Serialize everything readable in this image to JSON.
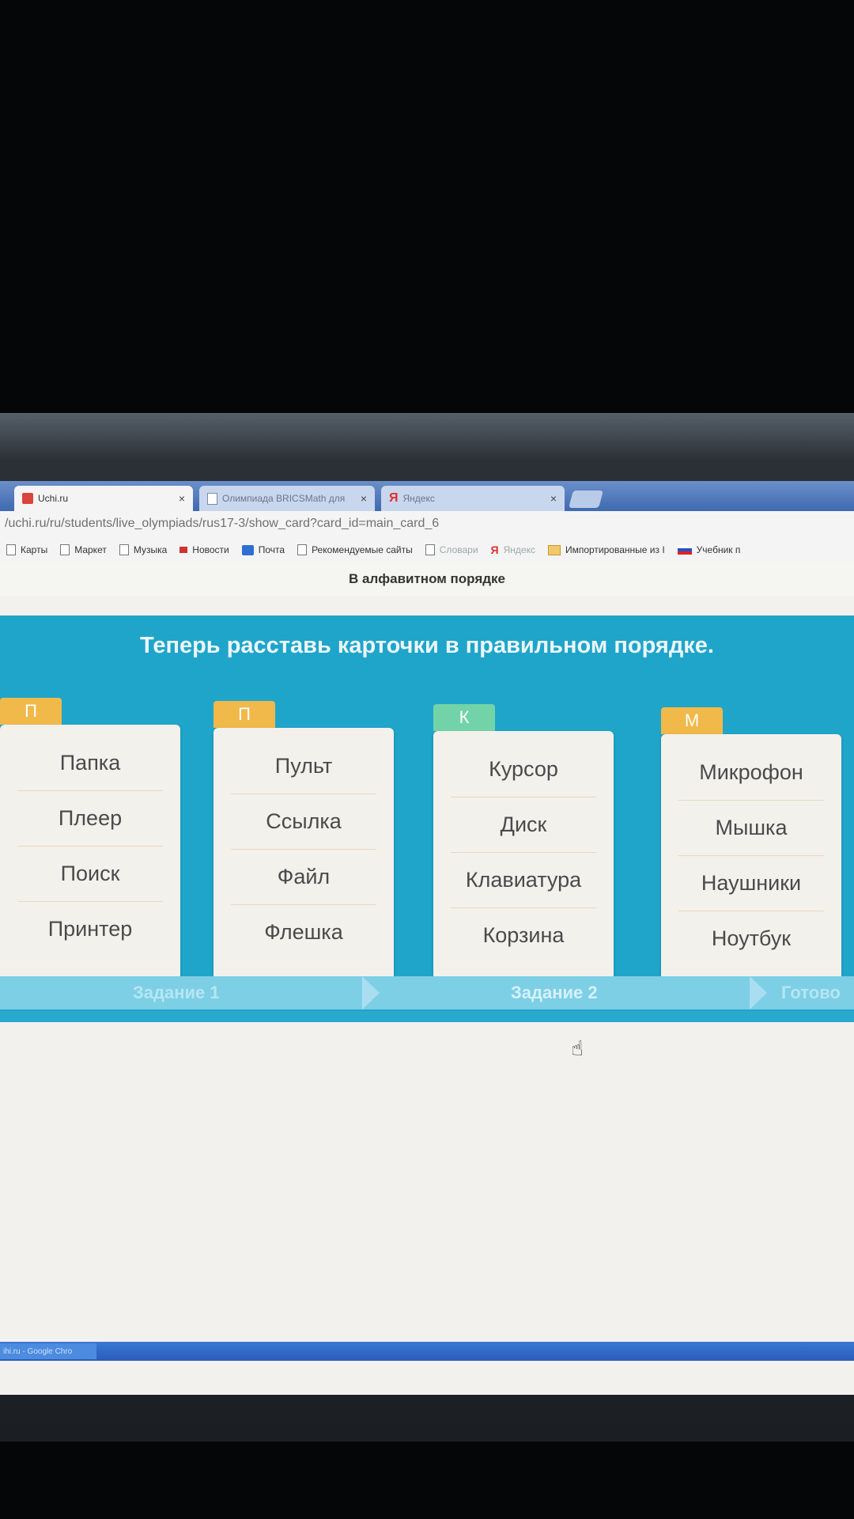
{
  "browser": {
    "tabs": [
      {
        "label": "Uchi.ru",
        "close": "×"
      },
      {
        "label": "Олимпиада BRICSMath для",
        "close": "×"
      },
      {
        "label": "Яндекс",
        "close": "×"
      }
    ],
    "url": "/uchi.ru/ru/students/live_olympiads/rus17-3/show_card?card_id=main_card_6",
    "bookmarks": [
      "Карты",
      "Маркет",
      "Музыка",
      "Новости",
      "Почта",
      "Рекомендуемые сайты",
      "Словари",
      "Яндекс",
      "Импортированные из I",
      "Учебник п"
    ]
  },
  "page": {
    "title": "В алфавитном порядке",
    "instruction": "Теперь расставь карточки в правильном порядке."
  },
  "groups": [
    {
      "letter": "П",
      "color": "#f0b94a",
      "words": [
        "Папка",
        "Плеер",
        "Поиск",
        "Принтер"
      ]
    },
    {
      "letter": "П",
      "color": "#f0b94a",
      "words": [
        "Пульт",
        "Ссылка",
        "Файл",
        "Флешка"
      ]
    },
    {
      "letter": "К",
      "color": "#72d3a8",
      "words": [
        "Курсор",
        "Диск",
        "Клавиатура",
        "Корзина"
      ]
    },
    {
      "letter": "М",
      "color": "#f0b94a",
      "words": [
        "Микрофон",
        "Мышка",
        "Наушники",
        "Ноутбук"
      ]
    }
  ],
  "progress": {
    "steps": [
      "Задание 1",
      "Задание 2",
      "Готово"
    ],
    "current_index": 1
  },
  "taskbar": {
    "item": "ihi.ru - Google Chro"
  },
  "colors": {
    "accent_blue": "#1fa5ca",
    "tag_yellow": "#f0b94a",
    "tag_green": "#72d3a8",
    "progress_bar": "#7dcfe6"
  }
}
